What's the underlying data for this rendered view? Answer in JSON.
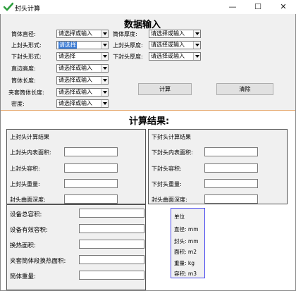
{
  "window": {
    "title": "封头计算",
    "minimize": "—",
    "maximize": "☐",
    "close": "✕",
    "accent": "#2e9e3e"
  },
  "input_section": {
    "title": "数据输入",
    "fields": [
      {
        "label": "筒体直径:",
        "value": "请选择或输入"
      },
      {
        "label": "上封头形式:",
        "value": "请选择",
        "selected": true
      },
      {
        "label": "下封头形式:",
        "value": "请选择"
      },
      {
        "label": "直边高度:",
        "value": "请选择或输入"
      },
      {
        "label": "筒体长度:",
        "value": "请选择或输入"
      },
      {
        "label": "夹套筒体长度:",
        "value": "请选择或输入"
      },
      {
        "label": "密度:",
        "value": "请选择或输入"
      }
    ],
    "right_fields": [
      {
        "label": "筒体厚度:",
        "value": "请选择或输入"
      },
      {
        "label": "上封头厚度:",
        "value": "请选择或输入"
      },
      {
        "label": "下封头厚度:",
        "value": "请选择或输入"
      }
    ],
    "calc_button": "计算",
    "clear_button": "清除"
  },
  "results_section": {
    "title": "计算结果:",
    "upper": {
      "title": "上封头计算结果",
      "fields": [
        "上封头内表面积:",
        "上封头容积:",
        "上封头重量:",
        "封头曲面深度:"
      ]
    },
    "lower": {
      "title": "下封头计算结果",
      "fields": [
        "下封头内表面积:",
        "下封头容积:",
        "下封头重量:",
        "封头曲面深度:"
      ]
    },
    "summary_fields": [
      "设备总容积:",
      "设备有效容积:",
      "换热面积:",
      "夹套筒体段换热面积:",
      "筒体重量:"
    ],
    "units": {
      "title": "单位",
      "rows": [
        "直径:  mm",
        "封头:  mm",
        "面积:  m2",
        "重量:  kg",
        "容积:  m3"
      ],
      "border_color": "#4a4af0"
    }
  }
}
